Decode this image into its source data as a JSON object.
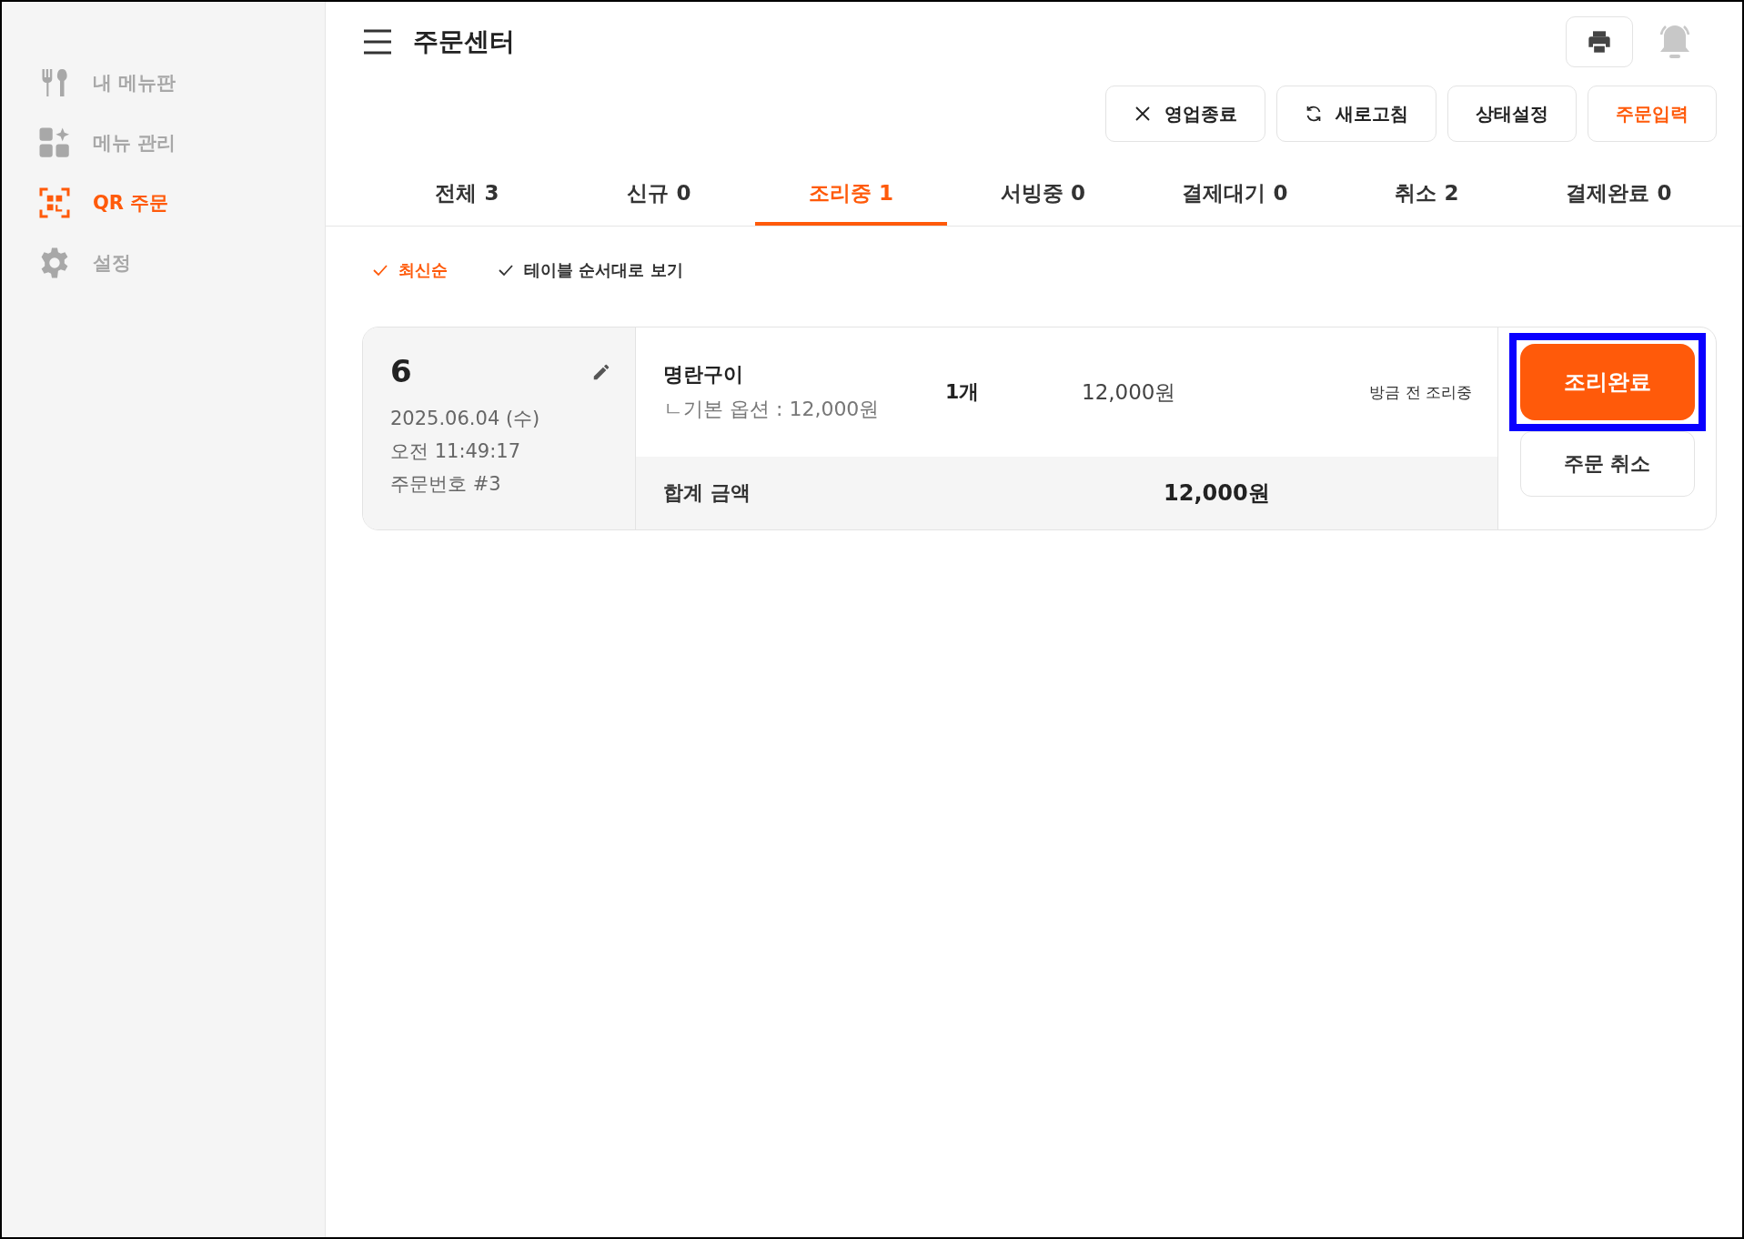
{
  "sidebar": {
    "items": [
      {
        "label": "내 메뉴판",
        "kind": "utensils",
        "selected": false
      },
      {
        "label": "메뉴 관리",
        "kind": "grid",
        "selected": false
      },
      {
        "label": "QR 주문",
        "kind": "qr",
        "selected": true
      },
      {
        "label": "설정",
        "kind": "gear",
        "selected": false
      }
    ]
  },
  "header": {
    "title": "주문센터"
  },
  "actions": [
    {
      "label": "영업종료",
      "kind": "close",
      "primary": false
    },
    {
      "label": "새로고침",
      "kind": "refresh",
      "primary": false
    },
    {
      "label": "상태설정",
      "kind": "plain",
      "primary": false
    },
    {
      "label": "주문입력",
      "kind": "plain",
      "primary": true
    }
  ],
  "tabs": [
    {
      "label": "전체 3",
      "selected": false
    },
    {
      "label": "신규 0",
      "selected": false
    },
    {
      "label": "조리중 1",
      "selected": true
    },
    {
      "label": "서빙중 0",
      "selected": false
    },
    {
      "label": "결제대기 0",
      "selected": false
    },
    {
      "label": "취소 2",
      "selected": false
    },
    {
      "label": "결제완료 0",
      "selected": false
    }
  ],
  "sort_options": [
    {
      "label": "최신순",
      "selected": true
    },
    {
      "label": "테이블 순서대로 보기",
      "selected": false
    }
  ],
  "orders": [
    {
      "table": "6",
      "date": "2025.06.04 (수)",
      "time": "오전 11:49:17",
      "order_no": "주문번호 #3",
      "items": [
        {
          "name": "명란구이",
          "option": "ㄴ기본 옵션 : 12,000원",
          "qty": "1개",
          "price": "12,000원",
          "status": "방금 전 조리중"
        }
      ],
      "total_label": "합계 금액",
      "total": "12,000원",
      "primary_action": "조리완료",
      "primary_highlighted": true,
      "secondary_action": "주문 취소"
    }
  ]
}
